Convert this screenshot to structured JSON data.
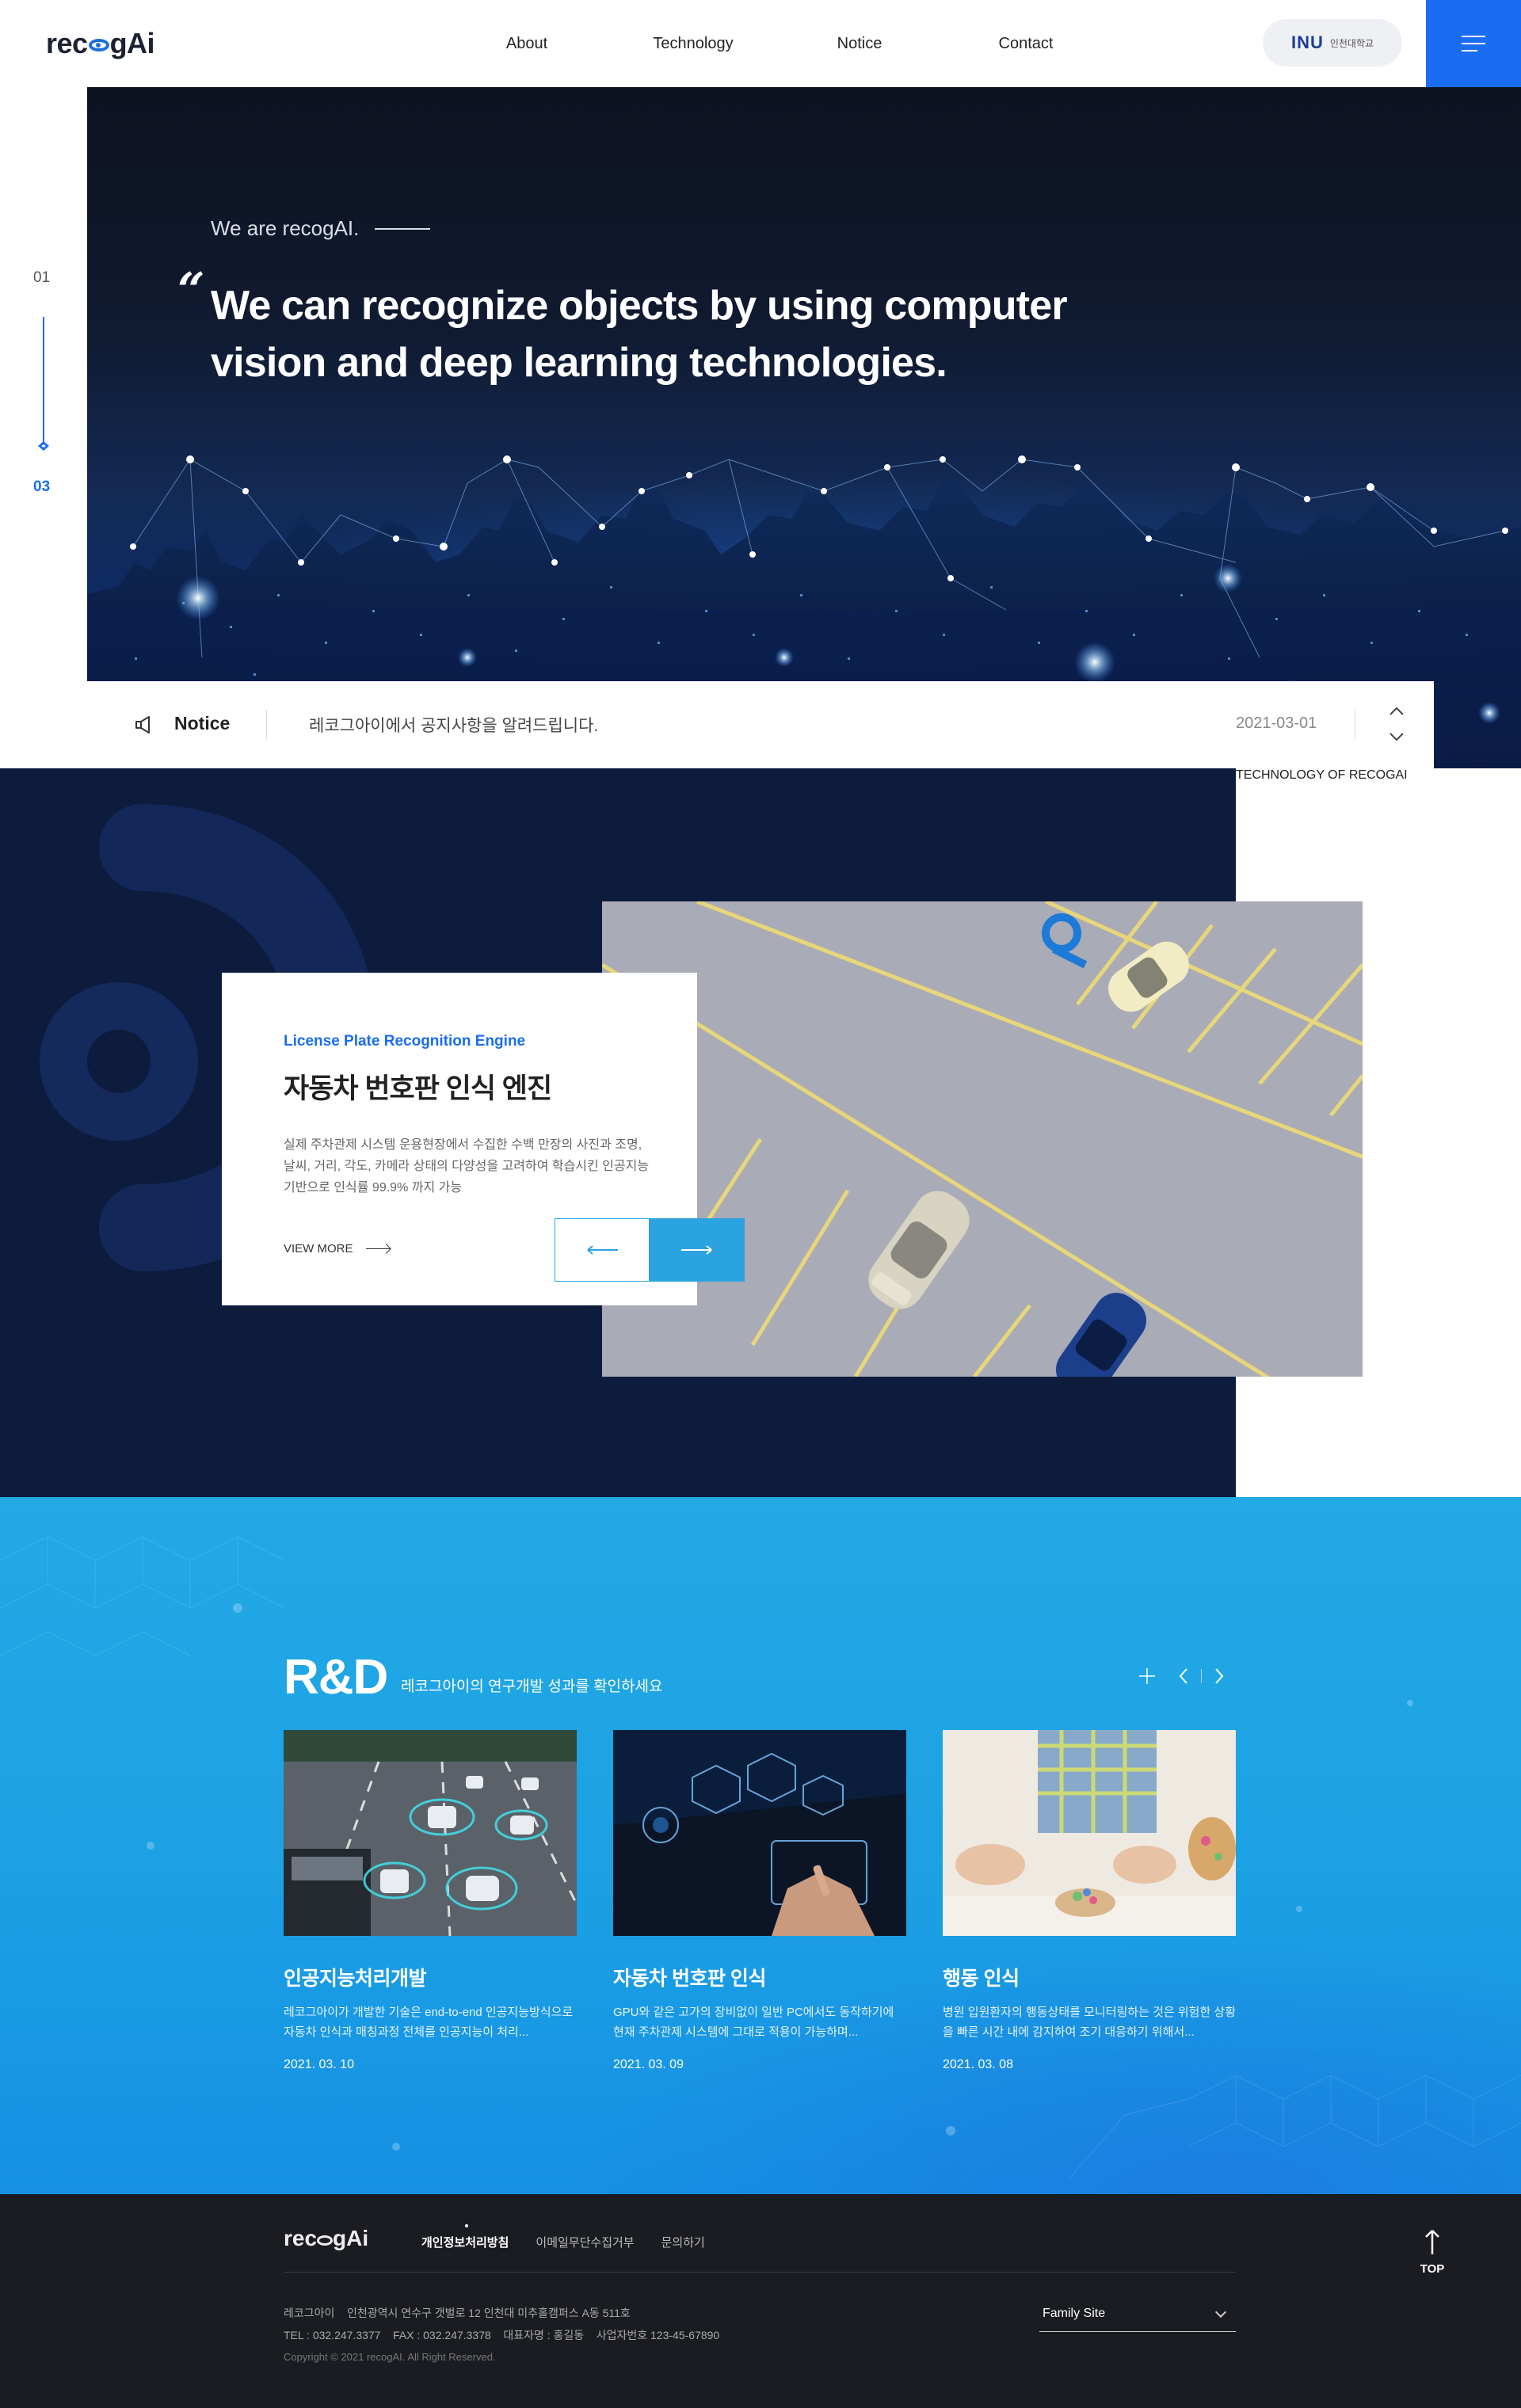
{
  "header": {
    "logo_text_a": "rec",
    "logo_text_b": "gAi",
    "nav": [
      "About",
      "Technology",
      "Notice",
      "Contact"
    ],
    "univ_badge": {
      "mark": "INU",
      "name": "인천대학교"
    }
  },
  "pager": {
    "current": "01",
    "total": "03"
  },
  "hero": {
    "kicker": "We are recogAI.",
    "quote_mark": "“",
    "title": "We can recognize objects by using computer vision and deep learning technologies."
  },
  "notice": {
    "label": "Notice",
    "message": "레코그아이에서 공지사항을 알려드립니다.",
    "date": "2021-03-01"
  },
  "technology": {
    "side_label": "TECHNOLOGY OF RECOGAI",
    "card": {
      "eyebrow": "License Plate Recognition Engine",
      "title": "자동차 번호판 인식 엔진",
      "description": "실제 주차관제 시스템 운용현장에서 수집한 수백 만장의 사진과 조명, 날씨, 거리, 각도, 카메라 상태의 다양성을 고려하여 학습시킨 인공지능 기반으로 인식률 99.9% 까지 가능",
      "more_label": "VIEW MORE"
    }
  },
  "rnd": {
    "title": "R&D",
    "subtitle": "레코그아이의 연구개발 성과를 확인하세요",
    "cards": [
      {
        "title": "인공지능처리개발",
        "description": "레코그아이가 개발한 기술은 end-to-end 인공지능방식으로 자동차 인식과 매칭과정 전체를 인공지능이 처리...",
        "date": "2021. 03. 10"
      },
      {
        "title": "자동차 번호판 인식",
        "description": "GPU와 같은 고가의 장비없이 일반 PC에서도 동작하기에 현재 주차관제 시스템에 그대로 적용이 가능하며...",
        "date": "2021. 03. 09"
      },
      {
        "title": "행동 인식",
        "description": "병원 입원환자의 행동상태를 모니터링하는 것은 위험한 상황을 빠른 시간 내에 감지하여 조기 대응하기 위해서...",
        "date": "2021. 03. 08"
      }
    ]
  },
  "footer": {
    "logo_text_a": "rec",
    "logo_text_b": "gAi",
    "links": [
      "개인정보처리방침",
      "이메일무단수집거부",
      "문의하기"
    ],
    "address_line1": "레코그아이    인천광역시 연수구 갯벌로 12 인천대 미추홀캠퍼스 A동 511호",
    "address_line2": "TEL : 032.247.3377    FAX : 032.247.3378    대표자명 : 홍길동    사업자번호 123-45-67890",
    "copyright": "Copyright © 2021 recogAI. All Right Reserved.",
    "family_site": "Family Site",
    "top_label": "TOP"
  },
  "colors": {
    "brand_blue": "#1a6df0",
    "accent_cyan": "#2ba3e0",
    "navy": "#0d1b3d",
    "footer_bg": "#1a1c22"
  }
}
